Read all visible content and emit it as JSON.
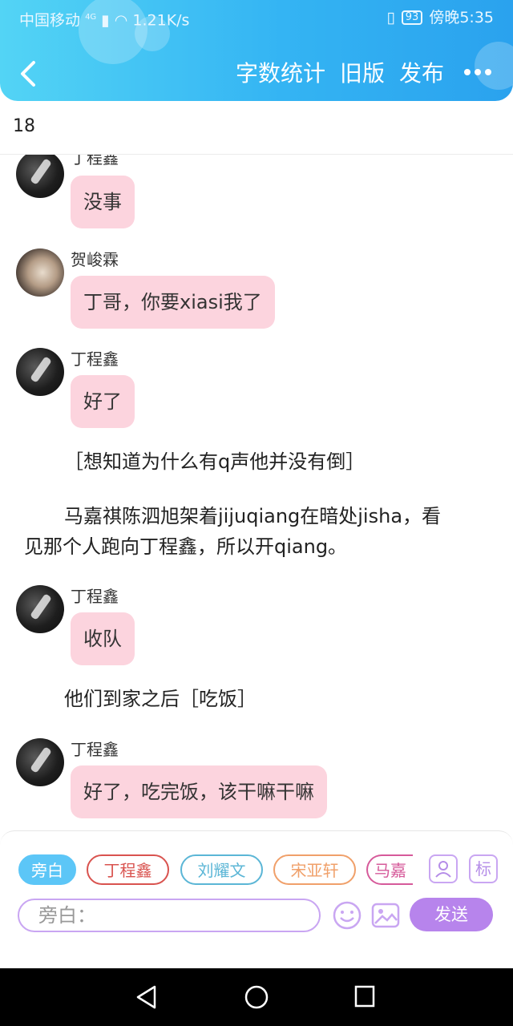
{
  "status_bar": {
    "carrier": "中国移动",
    "network": "4G",
    "speed": "1.21K/s",
    "battery": "93",
    "time": "傍晚5:35"
  },
  "header": {
    "back_icon": "chevron-left-icon",
    "actions": [
      "字数统计",
      "旧版",
      "发布"
    ],
    "more_icon": "more-dots-icon",
    "gradient": [
      "#53d4f5",
      "#2aa2ee"
    ]
  },
  "word_count": "18",
  "messages": [
    {
      "type": "dialog",
      "name": "丁程鑫",
      "text": "没事"
    },
    {
      "type": "dialog",
      "name": "贺峻霖",
      "text": "丁哥，你要xiasi我了"
    },
    {
      "type": "dialog",
      "name": "丁程鑫",
      "text": "好了"
    },
    {
      "type": "narration",
      "text": "［想知道为什么有q声他并没有倒］"
    },
    {
      "type": "narration",
      "line1": "马嘉祺陈泗旭架着jijuqiang在暗处jisha，看",
      "line2": "见那个人跑向丁程鑫，所以开qiang。"
    },
    {
      "type": "dialog",
      "name": "丁程鑫",
      "text": "收队"
    },
    {
      "type": "narration",
      "text": "他们到家之后［吃饭］"
    },
    {
      "type": "dialog",
      "name": "丁程鑫",
      "text": "好了，吃完饭，该干嘛干嘛"
    }
  ],
  "composer": {
    "roles": [
      {
        "label": "旁白",
        "color": "#5cc6f7"
      },
      {
        "label": "丁程鑫",
        "color": "#d9534f"
      },
      {
        "label": "刘耀文",
        "color": "#5bb6d6"
      },
      {
        "label": "宋亚轩",
        "color": "#f0a06a"
      },
      {
        "label": "马嘉",
        "color": "#d65a9a"
      }
    ],
    "role_icon": "person-card-icon",
    "tag_label": "标",
    "placeholder": "旁白：",
    "emoji_icon": "smiley-icon",
    "image_icon": "image-icon",
    "send_label": "发送",
    "accent": "#b784ec"
  },
  "system_nav": [
    "back-triangle-icon",
    "home-circle-icon",
    "recents-square-icon"
  ]
}
